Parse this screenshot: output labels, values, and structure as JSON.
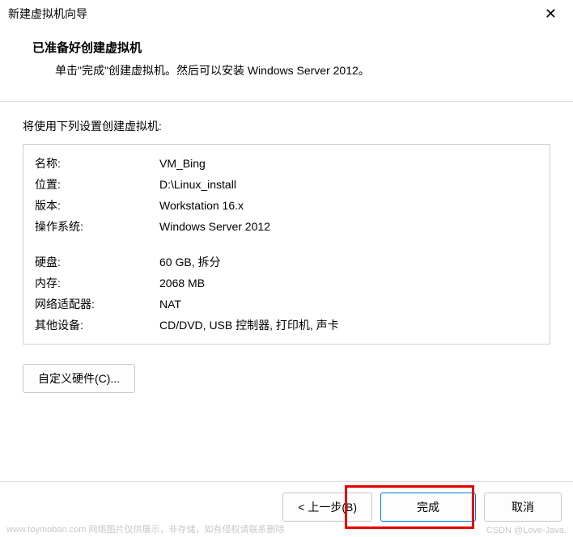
{
  "titlebar": {
    "title": "新建虚拟机向导"
  },
  "header": {
    "title": "已准备好创建虚拟机",
    "subtitle": "单击\"完成\"创建虚拟机。然后可以安装 Windows Server 2012。"
  },
  "intro": "将使用下列设置创建虚拟机:",
  "specs": {
    "name_label": "名称:",
    "name_value": "VM_Bing",
    "location_label": "位置:",
    "location_value": "D:\\Linux_install",
    "version_label": "版本:",
    "version_value": "Workstation 16.x",
    "os_label": "操作系统:",
    "os_value": "Windows Server 2012",
    "disk_label": "硬盘:",
    "disk_value": "60 GB, 拆分",
    "memory_label": "内存:",
    "memory_value": "2068 MB",
    "network_label": "网络适配器:",
    "network_value": "NAT",
    "other_label": "其他设备:",
    "other_value": "CD/DVD, USB 控制器, 打印机, 声卡"
  },
  "buttons": {
    "customize": "自定义硬件(C)...",
    "back": "< 上一步(B)",
    "finish": "完成",
    "cancel": "取消"
  },
  "watermark": {
    "left": "www.toymoban.com 网络图片仅供展示，非存储，如有侵权请联系删除",
    "right": "CSDN @Love-Java."
  }
}
